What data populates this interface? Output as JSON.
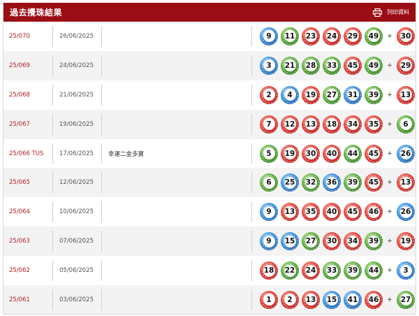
{
  "header": {
    "title": "過去攪珠結果",
    "print_label": "列印資料"
  },
  "colors": {
    "header_bg": "#9b0d14",
    "draw_link": "#b21b22",
    "red": "#e0443a",
    "blue": "#3b8fda",
    "green": "#5cac3e"
  },
  "rows": [
    {
      "draw": "25/070",
      "date": "26/06/2025",
      "note": "",
      "numbers": [
        9,
        11,
        23,
        24,
        29,
        49
      ],
      "extra": 30
    },
    {
      "draw": "25/069",
      "date": "24/06/2025",
      "note": "",
      "numbers": [
        3,
        21,
        28,
        33,
        45,
        49
      ],
      "extra": 29
    },
    {
      "draw": "25/068",
      "date": "21/06/2025",
      "note": "",
      "numbers": [
        2,
        4,
        19,
        27,
        31,
        39
      ],
      "extra": 13
    },
    {
      "draw": "25/067",
      "date": "19/06/2025",
      "note": "",
      "numbers": [
        7,
        12,
        13,
        18,
        34,
        35
      ],
      "extra": 6
    },
    {
      "draw": "25/066 TUS",
      "date": "17/06/2025",
      "note": "幸運二金多寶",
      "numbers": [
        5,
        19,
        30,
        40,
        44,
        45
      ],
      "extra": 26
    },
    {
      "draw": "25/065",
      "date": "12/06/2025",
      "note": "",
      "numbers": [
        6,
        25,
        32,
        36,
        39,
        45
      ],
      "extra": 13
    },
    {
      "draw": "25/064",
      "date": "10/06/2025",
      "note": "",
      "numbers": [
        9,
        13,
        35,
        40,
        45,
        46
      ],
      "extra": 26
    },
    {
      "draw": "25/063",
      "date": "07/06/2025",
      "note": "",
      "numbers": [
        9,
        15,
        27,
        30,
        34,
        39
      ],
      "extra": 19
    },
    {
      "draw": "25/062",
      "date": "05/06/2025",
      "note": "",
      "numbers": [
        18,
        22,
        24,
        33,
        39,
        44
      ],
      "extra": 3
    },
    {
      "draw": "25/061",
      "date": "03/06/2025",
      "note": "",
      "numbers": [
        1,
        2,
        13,
        15,
        41,
        46
      ],
      "extra": 27
    }
  ],
  "plus_sign": "+"
}
